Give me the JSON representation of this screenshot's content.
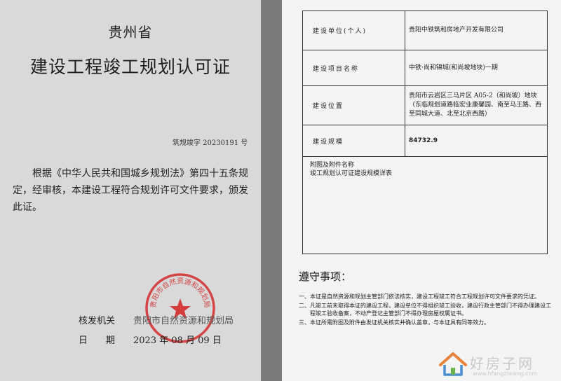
{
  "left": {
    "province": "贵州省",
    "title": "建设工程竣工规划认可证",
    "doc_number": "筑规竣字 20230191 号",
    "body": "根据《中华人民共和国城乡规划法》第四十五条规定，经审核，本建设工程符合规划许可文件要求，颁发此证。",
    "issuer_label": "核发机关",
    "issuer_value": "贵阳市自然资源和规划局",
    "date_label": "日　　期",
    "date_value": "2023 年 08 月 09 日",
    "seal_text": "贵阳市自然资源和规划局",
    "seal_color": "#d42a2a"
  },
  "right": {
    "rows": [
      {
        "label": "建设单位(个人)",
        "value": "贵阳中铁筑和房地产开发有限公司"
      },
      {
        "label": "建设项目名称",
        "value": "中铁·尚和锦城(和尚坡地块)一期"
      },
      {
        "label": "建设位置",
        "value": "贵阳市云岩区三马片区 A05-2（和尚坡）地块（东临规划道路临宏业康馨园、南至马王路、西至同城大道、北至北京西路）"
      },
      {
        "label": "建设规模",
        "value": "84732.9"
      }
    ],
    "attach_label": "附图及附件名称",
    "attach_value": "竣工规划认可证建设规模详表",
    "notice_title": "遵守事项：",
    "notices": [
      "一、本证是自然资源和规划主管部门依法核实，建设工程竣工符合工程规划许可文件要求的凭证。",
      "二、凡竣工前未取得本证的建设工程，建设单位不得组织竣工验收，建设行政主管部门不得办理建设工程竣工验收备案，不动产登记主管部门不得办理房屋权属证书。",
      "三、本证所需附图及附件由发证机关核实并确认盖章，与本证具有同等效力。"
    ]
  },
  "watermark": {
    "brand": "好房子网",
    "url": "www.hfangziwang.com"
  }
}
